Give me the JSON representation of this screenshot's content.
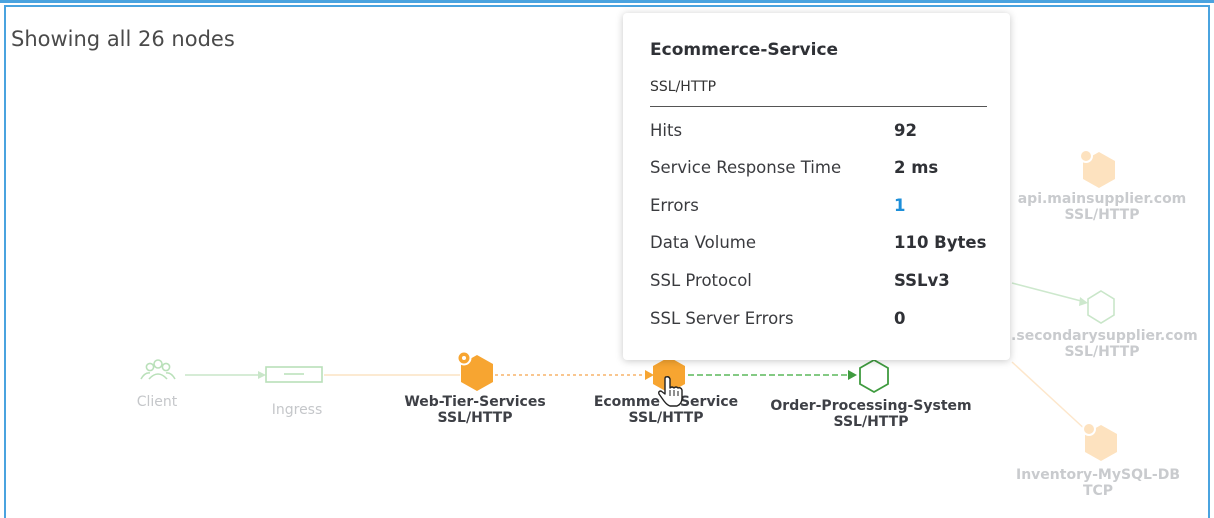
{
  "header": {
    "showing_text": "Showing all 26 nodes"
  },
  "colors": {
    "accent_border": "#4aa3df",
    "active_node": "#f7a531",
    "faded_node": "#fde2bf",
    "green_edge": "#5cb85c",
    "error_link": "#1d8fd9"
  },
  "nodes": {
    "client": {
      "name": "Client",
      "icon": "users-icon"
    },
    "ingress": {
      "name": "Ingress",
      "icon": "load-balancer-icon"
    },
    "web_tier": {
      "name": "Web-Tier-Services",
      "protocol": "SSL/HTTP",
      "icon": "hexagon-icon"
    },
    "ecommerce": {
      "name_left": "Ecomme",
      "name_right": "Service",
      "protocol": "SSL/HTTP",
      "icon": "hexagon-icon"
    },
    "order_processing": {
      "name": "Order-Processing-System",
      "protocol": "SSL/HTTP",
      "icon": "hexagon-outline-icon"
    },
    "main_supplier": {
      "name": "api.mainsupplier.com",
      "protocol": "SSL/HTTP",
      "icon": "hexagon-icon"
    },
    "secondary_supplier": {
      "name": "i.secondarysupplier.com",
      "protocol": "SSL/HTTP",
      "icon": "hexagon-outline-icon"
    },
    "inventory_db": {
      "name": "Inventory-MySQL-DB",
      "protocol": "TCP",
      "icon": "hexagon-icon"
    }
  },
  "tooltip": {
    "title": "Ecommerce-Service",
    "subtitle": "SSL/HTTP",
    "rows": [
      {
        "label": "Hits",
        "value": "92"
      },
      {
        "label": "Service Response Time",
        "value": "2 ms"
      },
      {
        "label": "Errors",
        "value": "1"
      },
      {
        "label": "Data Volume",
        "value": "110 Bytes"
      },
      {
        "label": "SSL Protocol",
        "value": "SSLv3"
      },
      {
        "label": "SSL Server Errors",
        "value": "0"
      }
    ]
  },
  "cursor": {
    "type": "hand-pointer"
  }
}
